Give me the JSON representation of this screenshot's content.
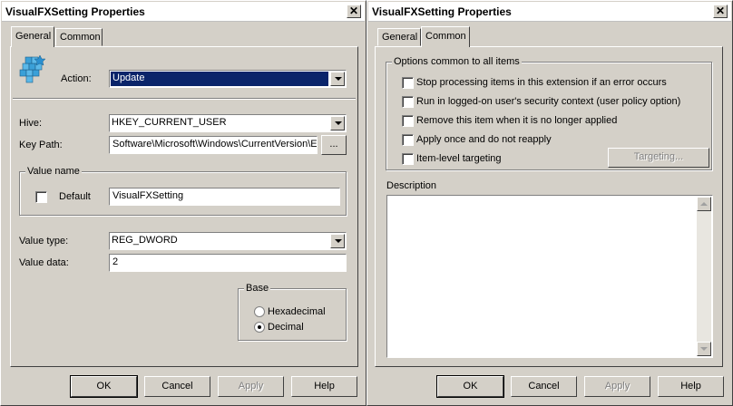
{
  "window_general": {
    "title": "VisualFXSetting Properties",
    "close_glyph": "✕",
    "tabs": [
      "General",
      "Common"
    ],
    "active_tab": "General",
    "action_label": "Action:",
    "action_value": "Update",
    "hive_label": "Hive:",
    "hive_value": "HKEY_CURRENT_USER",
    "key_path_label": "Key Path:",
    "key_path_value": "Software\\Microsoft\\Windows\\CurrentVersion\\E",
    "browse_label": "...",
    "value_name_group": "Value name",
    "default_label": "Default",
    "default_checked": false,
    "value_name": "VisualFXSetting",
    "value_type_label": "Value type:",
    "value_type": "REG_DWORD",
    "value_data_label": "Value data:",
    "value_data": "2",
    "base_group": "Base",
    "hexadecimal_label": "Hexadecimal",
    "decimal_label": "Decimal",
    "selected_base": "Decimal"
  },
  "window_common": {
    "title": "VisualFXSetting Properties",
    "close_glyph": "✕",
    "tabs": [
      "General",
      "Common"
    ],
    "active_tab": "Common",
    "options_group": "Options common to all items",
    "options": [
      {
        "label": "Stop processing items in this extension if an error occurs",
        "checked": false
      },
      {
        "label": "Run in logged-on user's security context (user policy option)",
        "checked": false
      },
      {
        "label": "Remove this item when it is no longer applied",
        "checked": false
      },
      {
        "label": "Apply once and do not reapply",
        "checked": false
      },
      {
        "label": "Item-level targeting",
        "checked": false
      }
    ],
    "targeting_button": "Targeting...",
    "description_label": "Description",
    "description_value": ""
  },
  "buttons": {
    "ok": "OK",
    "cancel": "Cancel",
    "apply": "Apply",
    "help": "Help"
  },
  "icons": {
    "registry": "registry-blocks-icon",
    "close": "close-icon"
  },
  "colors": {
    "face": "#d4d0c8",
    "selection": "#0a246a",
    "registry_icon": "#3aa0d8"
  }
}
